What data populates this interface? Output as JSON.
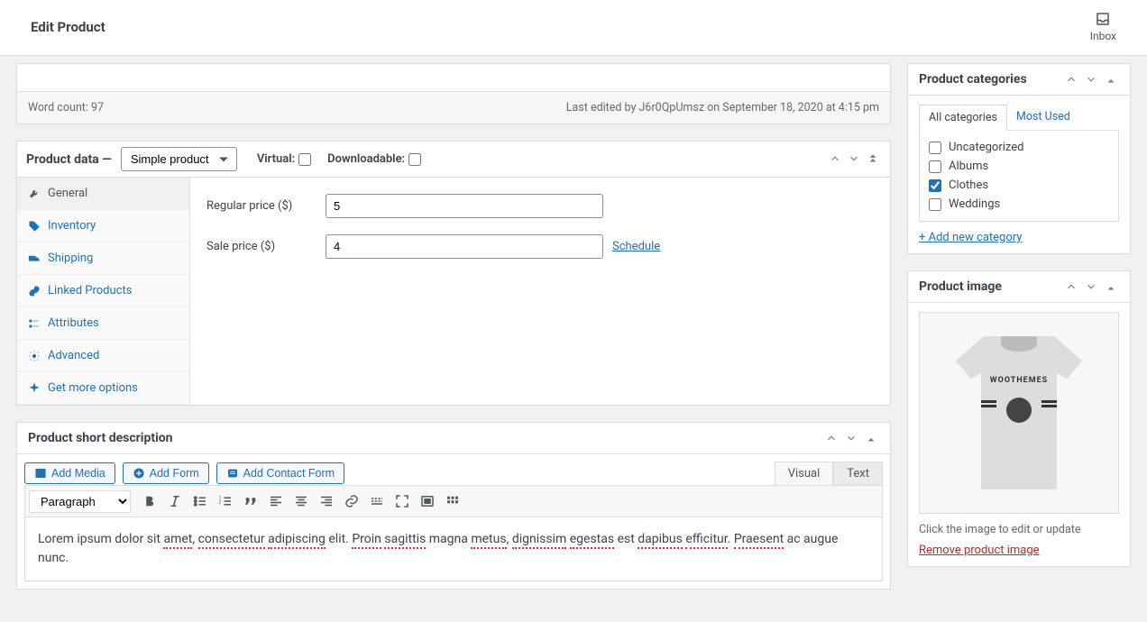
{
  "header": {
    "title": "Edit Product",
    "inbox": "Inbox"
  },
  "wordcount": {
    "label": "Word count: 97",
    "edited": "Last edited by J6r0QpUmsz on September 18, 2020 at 4:15 pm"
  },
  "productData": {
    "title": "Product data —",
    "typeSelected": "Simple product",
    "virtualLabel": "Virtual:",
    "downloadableLabel": "Downloadable:",
    "tabs": {
      "general": "General",
      "inventory": "Inventory",
      "shipping": "Shipping",
      "linked": "Linked Products",
      "attributes": "Attributes",
      "advanced": "Advanced",
      "more": "Get more options"
    },
    "regularPriceLabel": "Regular price ($)",
    "regularPriceValue": "5",
    "salePriceLabel": "Sale price ($)",
    "salePriceValue": "4",
    "scheduleLabel": "Schedule"
  },
  "shortDesc": {
    "title": "Product short description",
    "addMedia": "Add Media",
    "addForm": "Add Form",
    "addContactForm": "Add Contact Form",
    "visual": "Visual",
    "text": "Text",
    "paragraphLabel": "Paragraph",
    "content": {
      "p1a": "Lorem ipsum dolor sit ",
      "w1": "amet",
      "p1b": ", ",
      "w2": "consectetur",
      "sp": " ",
      "w3": "adipiscing",
      "p1c": " elit. ",
      "w4": "Proin",
      "sp2": " ",
      "w5": "sagittis",
      "p1d": " magna ",
      "w6": "metus",
      "p1e": ", ",
      "w7": "dignissim",
      "sp3": " ",
      "w8": "egestas",
      "p1f": " est ",
      "w9": "dapibus",
      "sp4": " ",
      "w10": "efficitur",
      "p1g": ". ",
      "w11": "Praesent",
      "p1h": " ac augue nunc."
    }
  },
  "categories": {
    "title": "Product categories",
    "allTab": "All categories",
    "mostUsedTab": "Most Used",
    "items": {
      "uncat": "Uncategorized",
      "albums": "Albums",
      "clothes": "Clothes",
      "weddings": "Weddings"
    },
    "addNew": "+ Add new category"
  },
  "productImage": {
    "title": "Product image",
    "shirtText": "WOOTHEMES",
    "hint": "Click the image to edit or update",
    "remove": "Remove product image"
  }
}
